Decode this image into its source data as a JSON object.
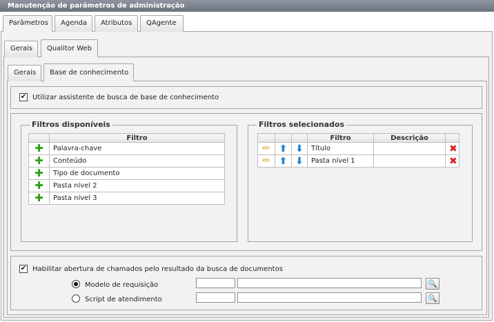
{
  "window": {
    "title": "Manutenção de parâmetros de administração"
  },
  "main_tabs": [
    {
      "label": "Parâmetros"
    },
    {
      "label": "Agenda"
    },
    {
      "label": "Atributos"
    },
    {
      "label": "QAgente"
    }
  ],
  "sub_tabs": [
    {
      "label": "Gerais"
    },
    {
      "label": "Qualitor Web"
    }
  ],
  "inner_tabs": [
    {
      "label": "Gerais"
    },
    {
      "label": "Base de conhecimento"
    }
  ],
  "assistant": {
    "label": "Utilizar assistente de busca de base de conhecimento",
    "checked": true
  },
  "available_filters": {
    "legend": "Filtros disponíveis",
    "column": "Filtro",
    "rows": [
      "Palavra-chave",
      "Conteúdo",
      "Tipo de documento",
      "Pasta nível 2",
      "Pasta nível 3"
    ]
  },
  "selected_filters": {
    "legend": "Filtros selecionados",
    "columns": {
      "filter": "Filtro",
      "description": "Descrição"
    },
    "rows": [
      {
        "filter": "Título",
        "description": ""
      },
      {
        "filter": "Pasta nível 1",
        "description": ""
      }
    ]
  },
  "tickets": {
    "label": "Habilitar abertura de chamados pelo resultado da busca de documentos",
    "checked": true,
    "options": [
      {
        "label": "Modelo de requisição",
        "selected": true,
        "code_value": "",
        "desc_value": ""
      },
      {
        "label": "Script de atendimento",
        "selected": false,
        "code_value": "",
        "desc_value": ""
      }
    ]
  },
  "icons": {
    "add": "plus-icon",
    "edit": "pencil-icon",
    "move_up": "arrow-up-icon",
    "move_down": "arrow-down-icon",
    "delete": "delete-icon",
    "search": "search-icon"
  },
  "colors": {
    "titlebar": "#7a818c",
    "panel": "#f2f2f2",
    "add": "#2f9e1c",
    "arrow": "#1f86d6",
    "delete": "#dd2222"
  }
}
